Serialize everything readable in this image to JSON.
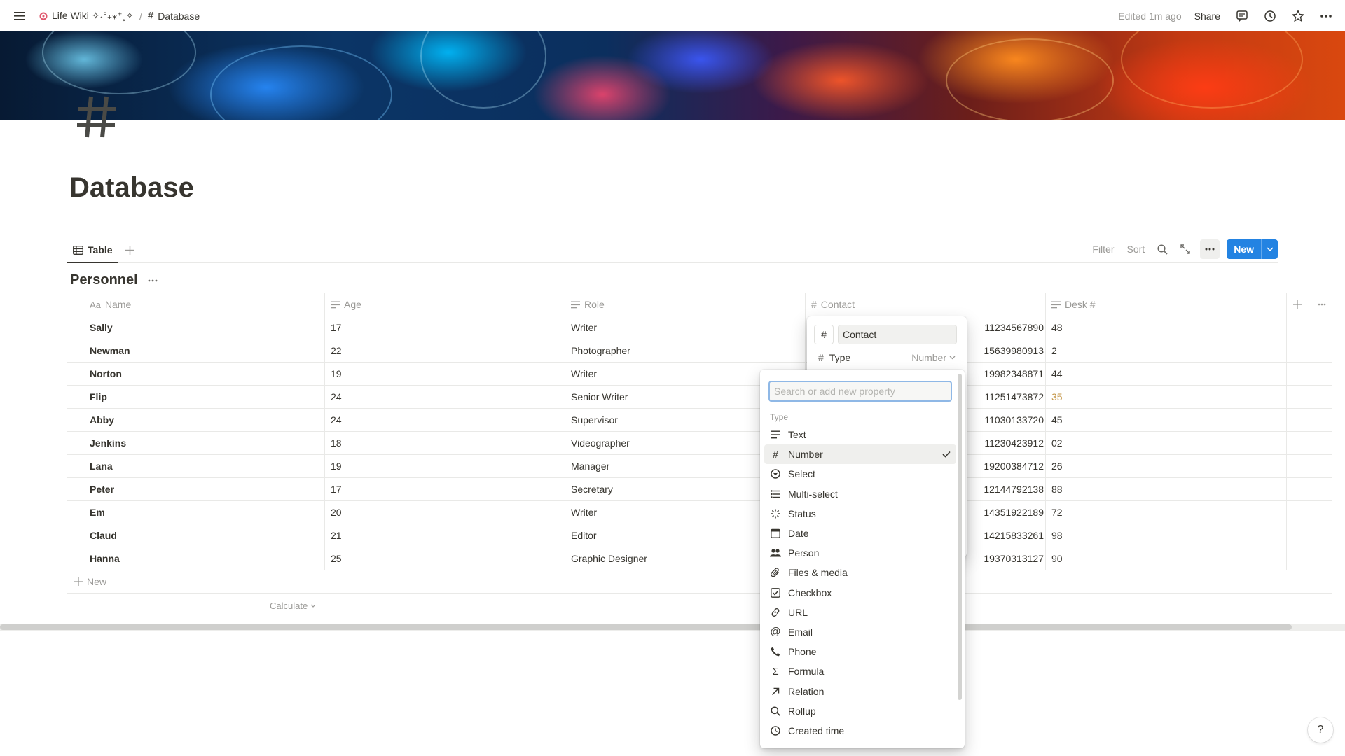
{
  "breadcrumb": {
    "workspace": "Life Wiki ✧˖°₊⁎⁺˳✧",
    "separator": "/",
    "page": "Database"
  },
  "topbar": {
    "edited": "Edited 1m ago",
    "share": "Share"
  },
  "page": {
    "title": "Database"
  },
  "views": {
    "active_tab": "Table",
    "filter": "Filter",
    "sort": "Sort",
    "new_label": "New"
  },
  "database": {
    "title": "Personnel",
    "columns": [
      {
        "label": "Name",
        "icon": "text-aa-icon"
      },
      {
        "label": "Age",
        "icon": "text-lines-icon"
      },
      {
        "label": "Role",
        "icon": "text-lines-icon"
      },
      {
        "label": "Contact",
        "icon": "hash-icon"
      },
      {
        "label": "Desk #",
        "icon": "text-lines-icon"
      }
    ],
    "rows": [
      {
        "name": "Sally",
        "age": "17",
        "role": "Writer",
        "contact": "11234567890",
        "desk": "48"
      },
      {
        "name": "Newman",
        "age": "22",
        "role": "Photographer",
        "contact": "15639980913",
        "desk": "2"
      },
      {
        "name": "Norton",
        "age": "19",
        "role": "Writer",
        "contact": "19982348871",
        "desk": "44"
      },
      {
        "name": "Flip",
        "age": "24",
        "role": "Senior Writer",
        "contact": "11251473872",
        "desk": "35"
      },
      {
        "name": "Abby",
        "age": "24",
        "role": "Supervisor",
        "contact": "11030133720",
        "desk": "45"
      },
      {
        "name": "Jenkins",
        "age": "18",
        "role": "Videographer",
        "contact": "11230423912",
        "desk": "02"
      },
      {
        "name": "Lana",
        "age": "19",
        "role": "Manager",
        "contact": "19200384712",
        "desk": "26"
      },
      {
        "name": "Peter",
        "age": "17",
        "role": "Secretary",
        "contact": "12144792138",
        "desk": "88"
      },
      {
        "name": "Em",
        "age": "20",
        "role": "Writer",
        "contact": "14351922189",
        "desk": "72"
      },
      {
        "name": "Claud",
        "age": "21",
        "role": "Editor",
        "contact": "14215833261",
        "desk": "98"
      },
      {
        "name": "Hanna",
        "age": "25",
        "role": "Graphic Designer",
        "contact": "19370313127",
        "desk": "90"
      }
    ],
    "new_row_label": "New",
    "calculate_label": "Calculate"
  },
  "property_editor": {
    "name_value": "Contact",
    "type_label": "Type",
    "type_value": "Number"
  },
  "type_menu": {
    "search_placeholder": "Search or add new property",
    "section_label": "Type",
    "items": [
      {
        "label": "Text",
        "icon": "text-lines-icon"
      },
      {
        "label": "Number",
        "icon": "hash-icon",
        "selected": true
      },
      {
        "label": "Select",
        "icon": "select-icon"
      },
      {
        "label": "Multi-select",
        "icon": "list-icon"
      },
      {
        "label": "Status",
        "icon": "status-icon"
      },
      {
        "label": "Date",
        "icon": "calendar-icon"
      },
      {
        "label": "Person",
        "icon": "people-icon"
      },
      {
        "label": "Files & media",
        "icon": "paperclip-icon"
      },
      {
        "label": "Checkbox",
        "icon": "checkbox-icon"
      },
      {
        "label": "URL",
        "icon": "link-icon"
      },
      {
        "label": "Email",
        "icon": "at-icon"
      },
      {
        "label": "Phone",
        "icon": "phone-icon"
      },
      {
        "label": "Formula",
        "icon": "sigma-icon"
      },
      {
        "label": "Relation",
        "icon": "arrow-up-right-icon"
      },
      {
        "label": "Rollup",
        "icon": "magnifier-icon"
      },
      {
        "label": "Created time",
        "icon": "clock-icon"
      }
    ]
  },
  "help": {
    "label": "?"
  },
  "colors": {
    "accent": "#2383e2",
    "highlight_number": "#c29343",
    "text": "#37352f",
    "muted": "#9b9a97"
  }
}
